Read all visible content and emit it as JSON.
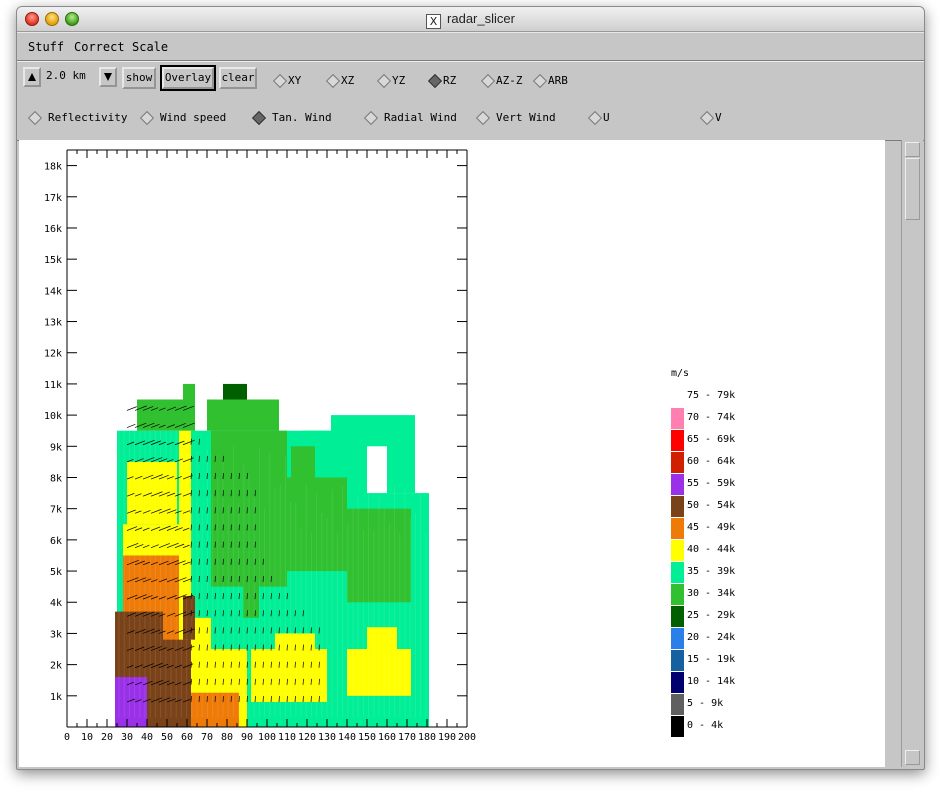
{
  "window": {
    "title": "radar_slicer"
  },
  "menu": [
    "Stuff",
    "Correct",
    "Scale"
  ],
  "toolbar": {
    "height_value": "2.0 km",
    "show_label": "show",
    "overlay_label": "Overlay",
    "clear_label": "clear",
    "views": [
      {
        "label": "XY",
        "selected": false
      },
      {
        "label": "XZ",
        "selected": false
      },
      {
        "label": "YZ",
        "selected": false
      },
      {
        "label": "RZ",
        "selected": true
      },
      {
        "label": "AZ-Z",
        "selected": false
      },
      {
        "label": "ARB",
        "selected": false
      }
    ],
    "fields": [
      {
        "label": "Reflectivity",
        "selected": false
      },
      {
        "label": "Wind speed",
        "selected": false
      },
      {
        "label": "Tan. Wind",
        "selected": true
      },
      {
        "label": "Radial Wind",
        "selected": false
      },
      {
        "label": "Vert Wind",
        "selected": false
      },
      {
        "label": "U",
        "selected": false
      },
      {
        "label": "V",
        "selected": false
      }
    ]
  },
  "chart_data": {
    "type": "heatmap",
    "x_ticks": [
      "0",
      "10",
      "20",
      "30",
      "40",
      "50",
      "60",
      "70",
      "80",
      "90",
      "100",
      "110",
      "120",
      "130",
      "140",
      "150",
      "160",
      "170",
      "180",
      "190",
      "200"
    ],
    "y_ticks": [
      "1k",
      "2k",
      "3k",
      "4k",
      "5k",
      "6k",
      "7k",
      "8k",
      "9k",
      "10k",
      "11k",
      "12k",
      "13k",
      "14k",
      "15k",
      "16k",
      "17k",
      "18k"
    ],
    "xlim": [
      0,
      200
    ],
    "ylim": [
      0,
      18.5
    ],
    "legend_unit": "m/s",
    "legend": [
      {
        "label": "75 - 79k",
        "color": "#ffffff"
      },
      {
        "label": "70 - 74k",
        "color": "#ff7fb0"
      },
      {
        "label": "65 - 69k",
        "color": "#ff0000"
      },
      {
        "label": "60 - 64k",
        "color": "#d02000"
      },
      {
        "label": "55 - 59k",
        "color": "#9a30e8"
      },
      {
        "label": "50 - 54k",
        "color": "#7a4218"
      },
      {
        "label": "45 - 49k",
        "color": "#ee7a08"
      },
      {
        "label": "40 - 44k",
        "color": "#ffff00"
      },
      {
        "label": "35 - 39k",
        "color": "#00ee96"
      },
      {
        "label": "30 - 34k",
        "color": "#30c030"
      },
      {
        "label": "25 - 29k",
        "color": "#006000"
      },
      {
        "label": "20 - 24k",
        "color": "#2a80e8"
      },
      {
        "label": "15 - 19k",
        "color": "#1460a0"
      },
      {
        "label": "10 - 14k",
        "color": "#00006e"
      },
      {
        "label": "5 - 9k",
        "color": "#606060"
      },
      {
        "label": "0 - 4k",
        "color": "#000000"
      }
    ],
    "regions": [
      {
        "x0": 28,
        "x1": 181,
        "y0": 0,
        "y1": 7.5,
        "color": "#00ee96"
      },
      {
        "x0": 25,
        "x1": 150,
        "y0": 0,
        "y1": 9.5,
        "color": "#00ee96"
      },
      {
        "x0": 35,
        "x1": 58,
        "y0": 9.5,
        "y1": 10.5,
        "color": "#30c030"
      },
      {
        "x0": 58,
        "x1": 64,
        "y0": 9.5,
        "y1": 11,
        "color": "#30c030"
      },
      {
        "x0": 70,
        "x1": 106,
        "y0": 9.5,
        "y1": 10.5,
        "color": "#30c030"
      },
      {
        "x0": 78,
        "x1": 90,
        "y0": 10.5,
        "y1": 11,
        "color": "#006000"
      },
      {
        "x0": 118,
        "x1": 132,
        "y0": 8.5,
        "y1": 9.5,
        "color": "#00ee96"
      },
      {
        "x0": 132,
        "x1": 160,
        "y0": 9,
        "y1": 10,
        "color": "#00ee96"
      },
      {
        "x0": 160,
        "x1": 174,
        "y0": 7.5,
        "y1": 10,
        "color": "#00ee96"
      },
      {
        "x0": 72,
        "x1": 110,
        "y0": 4.5,
        "y1": 9.5,
        "color": "#30c030"
      },
      {
        "x0": 110,
        "x1": 140,
        "y0": 5,
        "y1": 8,
        "color": "#30c030"
      },
      {
        "x0": 140,
        "x1": 172,
        "y0": 4,
        "y1": 7,
        "color": "#30c030"
      },
      {
        "x0": 112,
        "x1": 124,
        "y0": 8,
        "y1": 9,
        "color": "#30c030"
      },
      {
        "x0": 88,
        "x1": 96,
        "y0": 3.5,
        "y1": 5,
        "color": "#30c030"
      },
      {
        "x0": 28,
        "x1": 58,
        "y0": 0,
        "y1": 6.5,
        "color": "#ffff00"
      },
      {
        "x0": 30,
        "x1": 55,
        "y0": 6.5,
        "y1": 8.5,
        "color": "#ffff00"
      },
      {
        "x0": 56,
        "x1": 62,
        "y0": 3,
        "y1": 9.5,
        "color": "#ffff00"
      },
      {
        "x0": 62,
        "x1": 72,
        "y0": 0,
        "y1": 3.5,
        "color": "#ffff00"
      },
      {
        "x0": 72,
        "x1": 90,
        "y0": 0,
        "y1": 2.5,
        "color": "#ffff00"
      },
      {
        "x0": 92,
        "x1": 130,
        "y0": 0.8,
        "y1": 2.5,
        "color": "#ffff00"
      },
      {
        "x0": 104,
        "x1": 124,
        "y0": 2.5,
        "y1": 3,
        "color": "#ffff00"
      },
      {
        "x0": 140,
        "x1": 172,
        "y0": 1,
        "y1": 2.5,
        "color": "#ffff00"
      },
      {
        "x0": 150,
        "x1": 165,
        "y0": 2.5,
        "y1": 3.2,
        "color": "#ffff00"
      },
      {
        "x0": 28,
        "x1": 56,
        "y0": 0,
        "y1": 5.5,
        "color": "#ee7a08"
      },
      {
        "x0": 62,
        "x1": 86,
        "y0": 0,
        "y1": 1.1,
        "color": "#ee7a08"
      },
      {
        "x0": 24,
        "x1": 48,
        "y0": 0,
        "y1": 3.7,
        "color": "#7a4218"
      },
      {
        "x0": 48,
        "x1": 62,
        "y0": 0,
        "y1": 2.8,
        "color": "#7a4218"
      },
      {
        "x0": 58,
        "x1": 64,
        "y0": 2.8,
        "y1": 4.2,
        "color": "#7a4218"
      },
      {
        "x0": 24,
        "x1": 40,
        "y0": 0,
        "y1": 1.6,
        "color": "#9a30e8"
      }
    ],
    "wind_vectors_note": "overlay"
  }
}
